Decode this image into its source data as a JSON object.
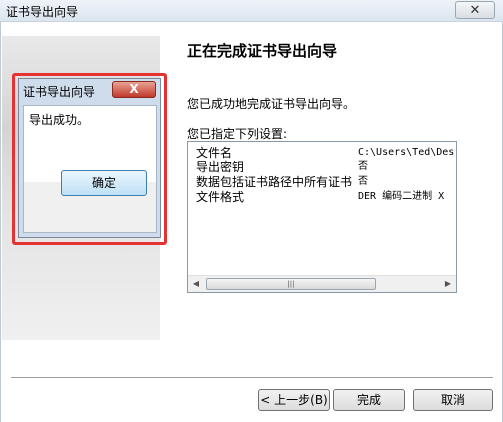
{
  "window": {
    "title": "证书导出向导",
    "close_glyph": "✕"
  },
  "main": {
    "heading": "正在完成证书导出向导",
    "description": "您已成功地完成证书导出向导。",
    "settings_label": "您已指定下列设置:",
    "settings": [
      {
        "key": "文件名",
        "value": "C:\\Users\\Ted\\Des"
      },
      {
        "key": "导出密钥",
        "value": "否"
      },
      {
        "key": "数据包括证书路径中所有证书",
        "value": "否"
      },
      {
        "key": "文件格式",
        "value": "DER 编码二进制 X"
      }
    ],
    "scroll_left": "◀",
    "scroll_right": "▶",
    "scroll_thumb": "|||"
  },
  "buttons": {
    "back": "< 上一步(B)",
    "finish": "完成",
    "cancel": "取消"
  },
  "dialog": {
    "title": "证书导出向导",
    "close_glyph": "X",
    "message": "导出成功。",
    "ok": "确定"
  },
  "colors": {
    "highlight": "#e53333",
    "dialog_close": "#c0392b",
    "ok_button": "#bfe0f6"
  }
}
